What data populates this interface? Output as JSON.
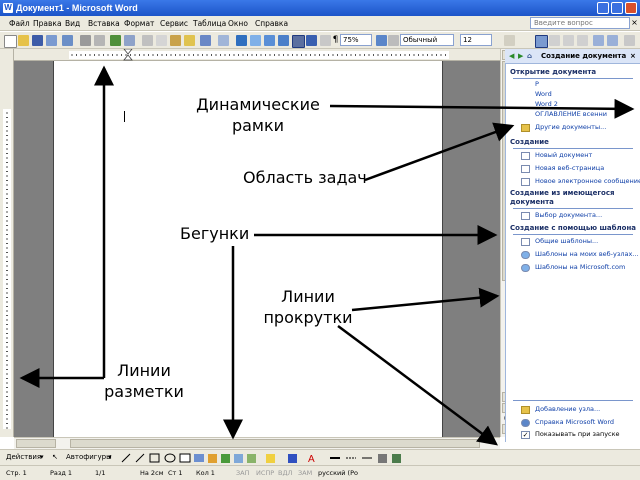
{
  "window": {
    "title": "Документ1 - Microsoft Word"
  },
  "menu": {
    "items": [
      "Файл",
      "Правка",
      "Вид",
      "Вставка",
      "Формат",
      "Сервис",
      "Таблица",
      "Окно",
      "Справка"
    ],
    "help_placeholder": "Введите вопрос",
    "close_doc": "×"
  },
  "toolbar": {
    "zoom": "75%",
    "style": "Обычный",
    "font_size": "12"
  },
  "task_pane": {
    "title": "Создание документа",
    "sections": {
      "open": {
        "title": "Открытие документа",
        "items": [
          "Р",
          "Word",
          "Word 2",
          "ОГЛАВЛЕНИЕ всенни"
        ],
        "more": "Другие документы..."
      },
      "create": {
        "title": "Создание",
        "items": [
          "Новый документ",
          "Новая веб-страница",
          "Новое электронное сообщение"
        ]
      },
      "from_existing": {
        "title": "Создание из имеющегося документа",
        "items": [
          "Выбор документа..."
        ]
      },
      "from_template": {
        "title": "Создание с помощью шаблона",
        "items": [
          "Общие шаблоны...",
          "Шаблоны на моих веб-узлах...",
          "Шаблоны на Microsoft.com"
        ]
      },
      "bottom": {
        "items": [
          "Добавление узла...",
          "Справка Microsoft Word"
        ],
        "show_at_startup": "Показывать при запуске"
      }
    }
  },
  "drawing_toolbar": {
    "actions": "Действия",
    "autoshapes": "Автофигуры"
  },
  "status_bar": {
    "page": "Стр. 1",
    "section": "Разд 1",
    "pages": "1/1",
    "at": "На 2см",
    "line": "Ст 1",
    "col": "Кол 1",
    "rec": "ЗАП",
    "trk": "ИСПР",
    "ext": "ВДЛ",
    "ovr": "ЗАМ",
    "lang": "русский (Ро"
  },
  "annotations": {
    "dynamic_frames": "Динамические рамки",
    "task_pane": "Область задач",
    "sliders": "Бегунки",
    "scroll_lines": "Линии прокрутки",
    "ruler_lines": "Линии разметки"
  },
  "colors": {
    "title_bar": "#1c54c8",
    "chrome": "#eceadf",
    "task_pane_header": "#dbe5f7",
    "doc_background": "#7f7f7f",
    "link": "#1040a8"
  }
}
